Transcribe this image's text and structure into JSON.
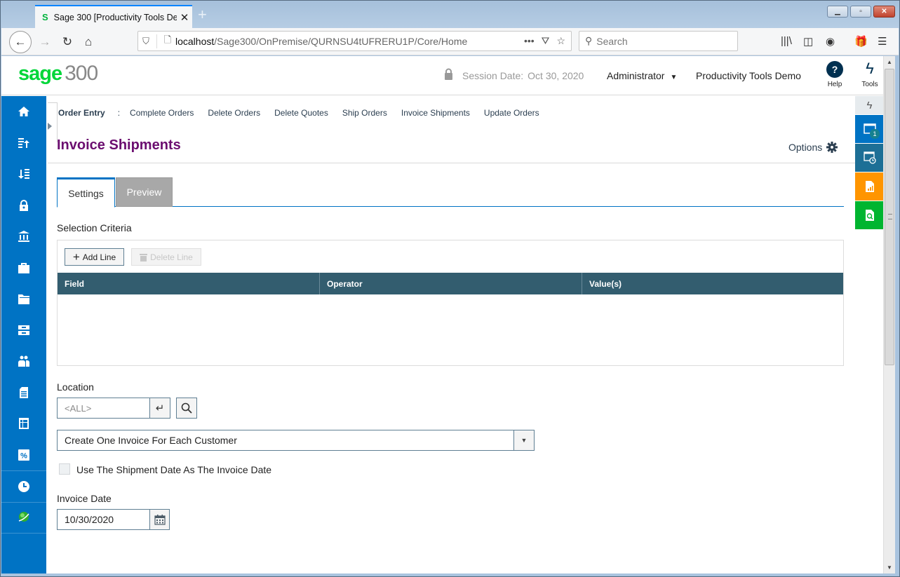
{
  "browser": {
    "tab_title": "Sage 300 [Productivity Tools De",
    "tab_favicon": "S",
    "url_host": "localhost",
    "url_path": "/Sage300/OnPremise/QURNSU4tUFRERU1P/Core/Home",
    "search_placeholder": "Search",
    "icons": [
      "back-icon",
      "forward-icon",
      "reload-icon",
      "home-icon",
      "shield-icon",
      "page-icon",
      "more-icon",
      "pocket-icon",
      "star-icon",
      "library-icon",
      "sidebar-icon",
      "account-icon",
      "gift-icon",
      "menu-icon"
    ]
  },
  "header": {
    "logo_brand": "sage",
    "logo_product": "300",
    "session_label": "Session Date:",
    "session_date": "Oct 30, 2020",
    "user": "Administrator",
    "company": "Productivity Tools Demo",
    "help_label": "Help",
    "help_glyph": "?",
    "tools_label": "Tools"
  },
  "sidebar": {
    "items": [
      {
        "icon": "home-icon"
      },
      {
        "icon": "sort-up-list-icon"
      },
      {
        "icon": "sort-down-list-icon"
      },
      {
        "icon": "lock-icon"
      },
      {
        "icon": "bank-icon"
      },
      {
        "icon": "briefcase-icon"
      },
      {
        "icon": "folder-icon"
      },
      {
        "icon": "cabinet-icon"
      },
      {
        "icon": "users-icon"
      },
      {
        "icon": "document-icon"
      },
      {
        "icon": "table-icon"
      },
      {
        "icon": "percent-icon"
      },
      {
        "icon": "clock-icon"
      },
      {
        "icon": "globe-icon"
      }
    ]
  },
  "breadcrumb": {
    "root": "Order Entry",
    "separator": ":",
    "links": [
      "Complete Orders",
      "Delete Orders",
      "Delete Quotes",
      "Ship Orders",
      "Invoice Shipments",
      "Update Orders"
    ]
  },
  "page": {
    "title": "Invoice Shipments",
    "options_label": "Options",
    "tabs": [
      {
        "label": "Settings",
        "active": true
      },
      {
        "label": "Preview",
        "active": false
      }
    ],
    "selection_criteria_label": "Selection Criteria",
    "add_line_label": "Add Line",
    "delete_line_label": "Delete Line",
    "grid_columns": [
      "Field",
      "Operator",
      "Value(s)"
    ],
    "grid_rows": [],
    "location_label": "Location",
    "location_placeholder": "<ALL>",
    "invoice_option": "Create One Invoice For Each Customer",
    "use_shipment_date_label": "Use The Shipment Date As The Invoice Date",
    "use_shipment_date_checked": false,
    "invoice_date_label": "Invoice Date",
    "invoice_date": "10/30/2020"
  },
  "rail": {
    "open_windows_badge": "1"
  },
  "colors": {
    "sidebar": "#0073c4",
    "title": "#6b0d6f",
    "grid_header": "#335d6f",
    "rail_orange": "#ff9500",
    "rail_green": "#00b530"
  }
}
